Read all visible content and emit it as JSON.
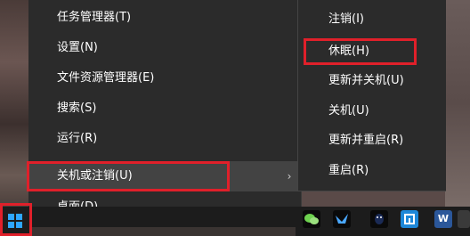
{
  "main_menu": {
    "items": [
      {
        "label": "任务管理器(T)"
      },
      {
        "label": "设置(N)"
      },
      {
        "label": "文件资源管理器(E)"
      },
      {
        "label": "搜索(S)"
      },
      {
        "label": "运行(R)"
      },
      {
        "label": "关机或注销(U)"
      },
      {
        "label": "桌面(D)"
      }
    ],
    "selected_index": 5,
    "submenu_arrow": "›"
  },
  "submenu": {
    "items": [
      {
        "label": "注销(I)"
      },
      {
        "label": "休眠(H)"
      },
      {
        "label": "更新并关机(U)"
      },
      {
        "label": "关机(U)"
      },
      {
        "label": "更新并重启(R)"
      },
      {
        "label": "重启(R)"
      }
    ]
  },
  "taskbar": {
    "start_icon": "windows-logo-icon",
    "apps": [
      {
        "icon": "wechat-icon"
      },
      {
        "icon": "feishu-bird-icon"
      },
      {
        "icon": "qq-icon"
      },
      {
        "icon": "app-tile-icon"
      },
      {
        "icon": "word-icon",
        "glyph": "W"
      },
      {
        "icon": "app-icon"
      }
    ]
  },
  "colors": {
    "menu_bg": "#2b2b2b",
    "menu_selected": "#434343",
    "highlight": "#e0202a",
    "taskbar": "#1c1c1c",
    "windows_blue": "#2ea7ff"
  }
}
